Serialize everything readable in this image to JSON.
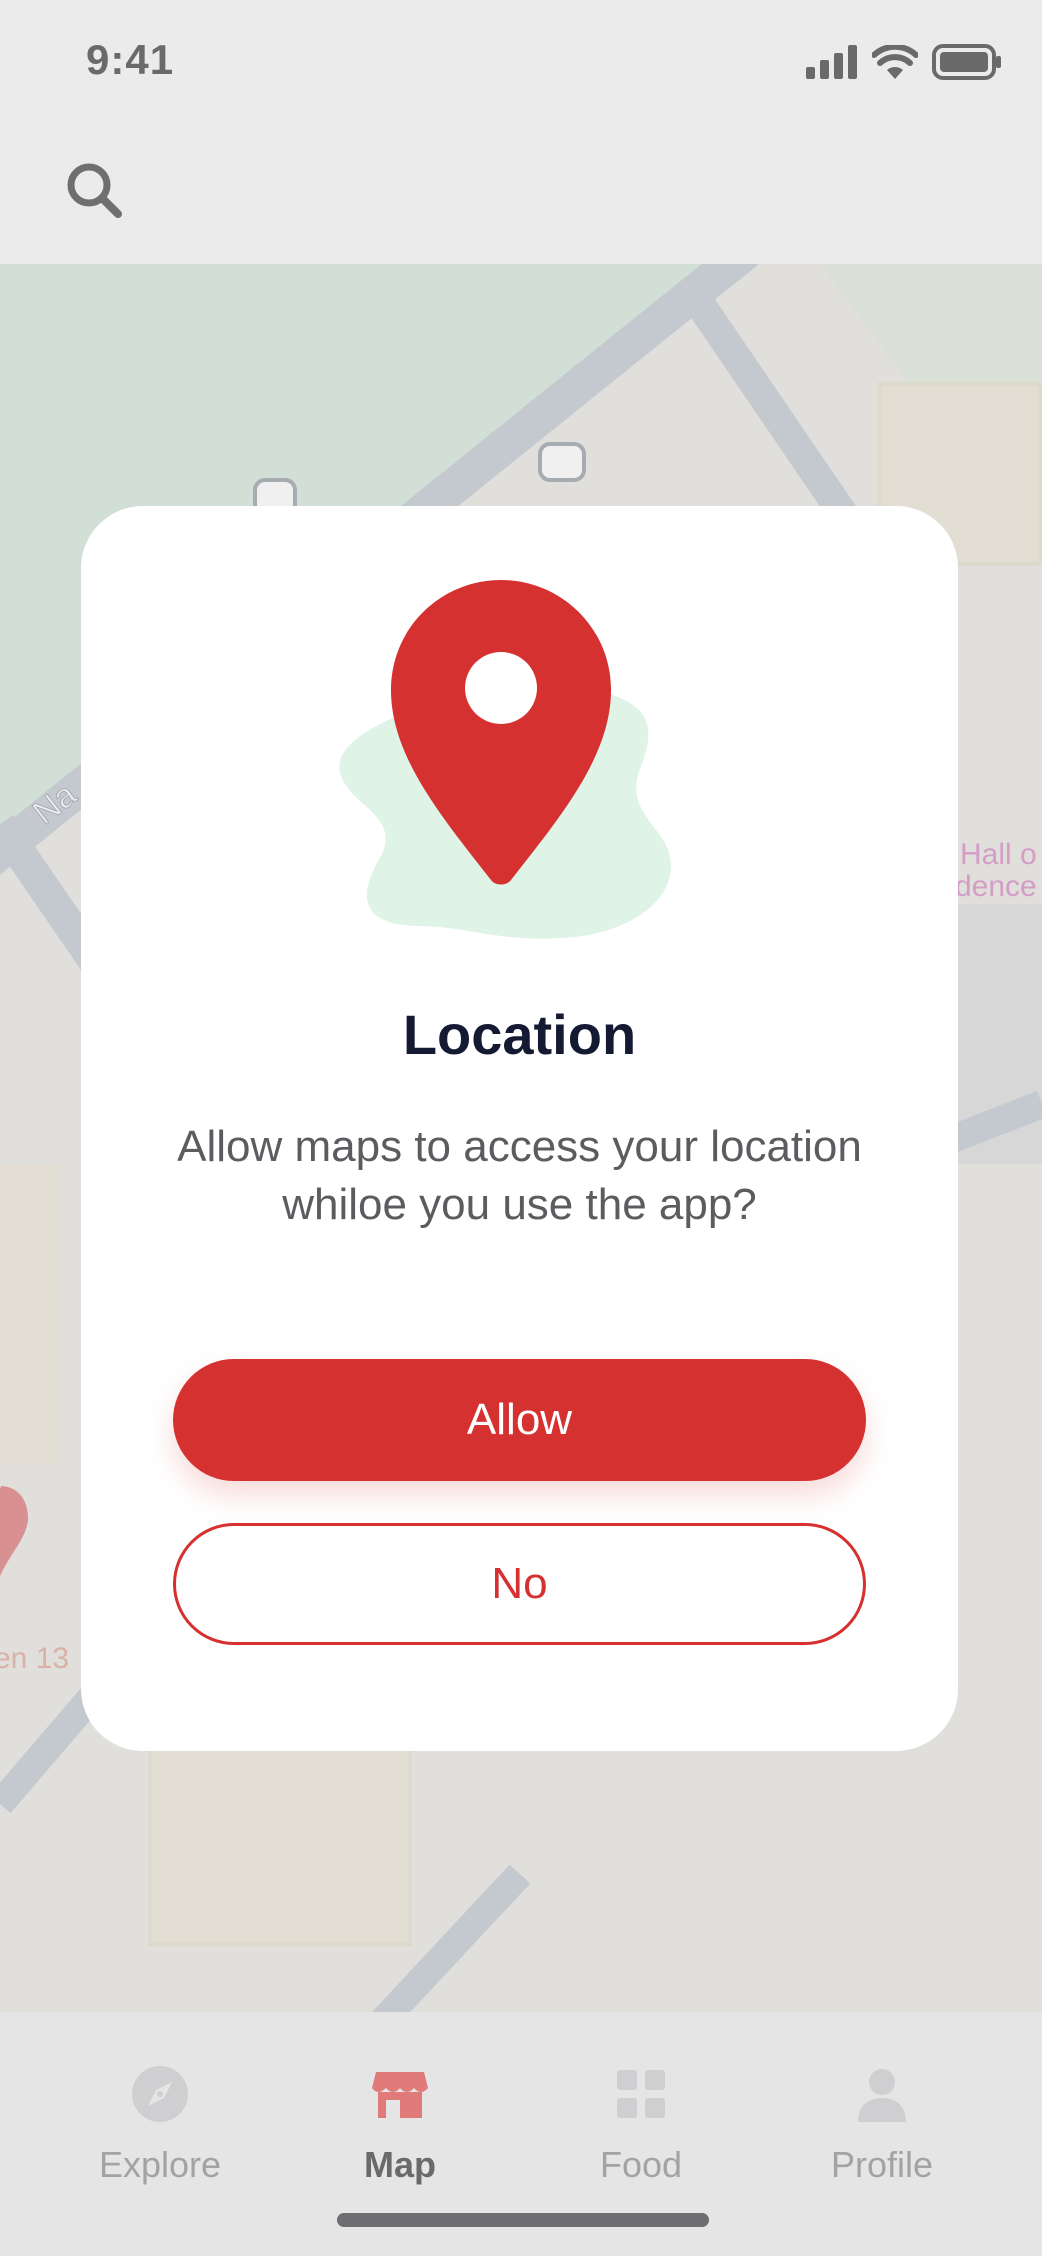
{
  "status_bar": {
    "time": "9:41"
  },
  "map": {
    "labels": {
      "road": "Na",
      "hall": "Hall o",
      "residence": "dence",
      "pin": "en 13"
    }
  },
  "dialog": {
    "title": "Location",
    "message": "Allow maps to access your location whiloe you use the app?",
    "allow_label": "Allow",
    "no_label": "No"
  },
  "tabbar": {
    "active": "Map",
    "tabs": [
      {
        "label": "Explore",
        "icon": "compass-icon"
      },
      {
        "label": "Map",
        "icon": "store-icon"
      },
      {
        "label": "Food",
        "icon": "grid-icon"
      },
      {
        "label": "Profile",
        "icon": "person-icon"
      }
    ]
  },
  "colors": {
    "accent": "#d53130",
    "text_dark": "#151a33",
    "muted": "#a3a3a6"
  }
}
